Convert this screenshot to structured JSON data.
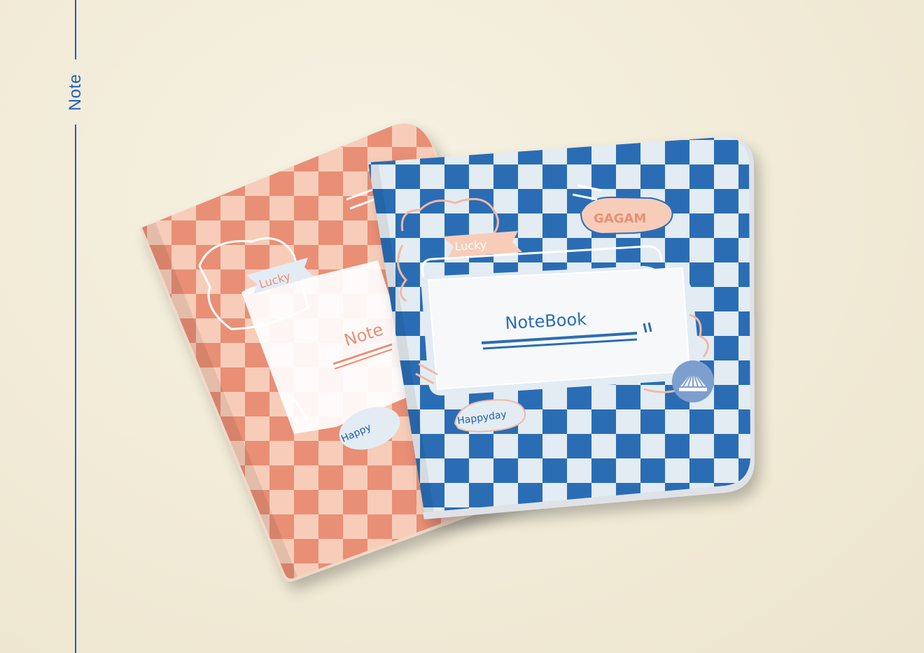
{
  "side_label": "Note",
  "back_notebook": {
    "sticker_lucky": "Lucky",
    "title": "Note",
    "sticker_happy": "Happy"
  },
  "front_notebook": {
    "sticker_lucky": "Lucky",
    "brand": "GAGAM",
    "title": "NoteBook",
    "sticker_happy": "Happyday"
  },
  "colors": {
    "background": "#f1ead6",
    "accent_blue": "#1f5fb0",
    "blue_check": "#2a6db5",
    "light_check": "#e3ecf3",
    "salmon_check": "#e98f76",
    "pink_check": "#f7cdb9"
  }
}
